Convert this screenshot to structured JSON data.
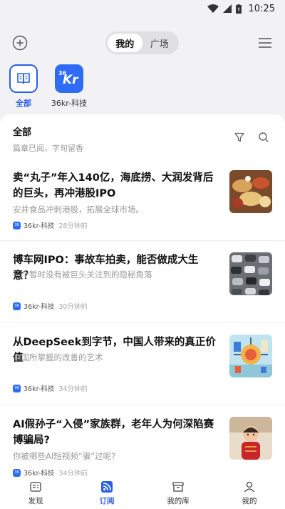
{
  "status": {
    "time": "10:25"
  },
  "header": {
    "tabs": [
      {
        "label": "我的",
        "active": true
      },
      {
        "label": "广场",
        "active": false
      }
    ]
  },
  "channels": [
    {
      "label": "全部",
      "active": true
    },
    {
      "label": "36kr-科技",
      "active": false,
      "logo": "36Kr"
    }
  ],
  "feed": {
    "title": "全部",
    "subtitle": "篇章已阅，字句留香",
    "articles": [
      {
        "title": "卖“丸子”年入140亿，海底捞、大润发背后的巨头，再冲港股IPO",
        "desc": "安井食品冲刺港股，拓展全球市场。",
        "source": "36kr-科技",
        "time": "28分钟前",
        "thumb": "food-image"
      },
      {
        "title": "博车网IPO：事故车拍卖，能否做成大生意？",
        "desc": "一个暂时没有被巨头关注到的隐秘角落",
        "source": "36kr-科技",
        "time": "30分钟前",
        "thumb": "cars-image"
      },
      {
        "title": "从DeepSeek到字节，中国人带来的真正价值",
        "desc": "中国所掌握的改善的艺术",
        "source": "36kr-科技",
        "time": "34分钟前",
        "thumb": "illustration-image"
      },
      {
        "title": "AI假孙子“入侵”家族群，老年人为何深陷赛博骗局?",
        "desc": "你被哪些AI短视频“骗”过呢?",
        "source": "36kr-科技",
        "time": "34分钟前",
        "thumb": "baby-image"
      }
    ]
  },
  "bottom_nav": [
    {
      "label": "发现",
      "icon": "discover-icon",
      "active": false
    },
    {
      "label": "订阅",
      "icon": "rss-icon",
      "active": true
    },
    {
      "label": "我的库",
      "icon": "library-icon",
      "active": false
    },
    {
      "label": "我的",
      "icon": "profile-icon",
      "active": false
    }
  ],
  "colors": {
    "accent": "#2b5fe4",
    "brand36kr": "#2f6cf6"
  }
}
